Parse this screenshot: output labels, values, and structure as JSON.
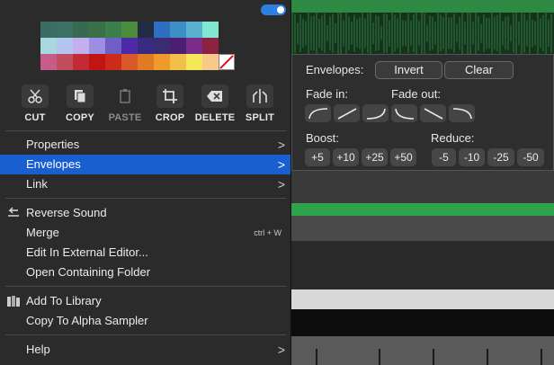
{
  "colors": {
    "accent": "#1a5fd0",
    "toggle": "#2d7fe0",
    "menu_bg": "#2b2b2b",
    "waveform_green": "#2e8a43"
  },
  "palette": {
    "rows": [
      [
        "#3b6e63",
        "#3c7064",
        "#376a50",
        "#3a7047",
        "#3b7f4d",
        "#4a8c3b",
        "#232a44",
        "#2f6ec0",
        "#3d8ec4",
        "#5ab0d0",
        "#83e6d3"
      ],
      [
        "#a8d7e0",
        "#b4c6ef",
        "#c3aef0",
        "#9a8fe3",
        "#6e5fc6",
        "#4d2aa6",
        "#372a80",
        "#3a2c70",
        "#4a1f73",
        "#7b2b8a",
        "#8a2240"
      ],
      [
        "#c65c8a",
        "#c14e5d",
        "#c22a36",
        "#c21414",
        "#cc2b1a",
        "#d85a2a",
        "#e27a22",
        "#ef9a2b",
        "#f0c04a",
        "#f3e85a",
        "#f7c98a"
      ]
    ],
    "clear_swatch_icon": "no-color-icon"
  },
  "toolbar": {
    "cut": "CUT",
    "copy": "COPY",
    "paste": "PASTE",
    "crop": "CROP",
    "delete": "DELETE",
    "split": "SPLIT"
  },
  "menu": {
    "properties": "Properties",
    "envelopes": "Envelopes",
    "link": "Link",
    "reverse": "Reverse Sound",
    "merge": "Merge",
    "merge_shortcut": "ctrl + W",
    "edit_external": "Edit In External Editor...",
    "open_folder": "Open Containing Folder",
    "add_library": "Add To Library",
    "copy_alpha": "Copy To Alpha Sampler",
    "help": "Help"
  },
  "envelopes": {
    "title": "Envelopes:",
    "invert": "Invert",
    "clear": "Clear",
    "fade_in": "Fade in:",
    "fade_out": "Fade out:",
    "boost": "Boost:",
    "reduce": "Reduce:",
    "boost_values": [
      "+5",
      "+10",
      "+25",
      "+50"
    ],
    "reduce_values": [
      "-5",
      "-10",
      "-25",
      "-50"
    ]
  }
}
